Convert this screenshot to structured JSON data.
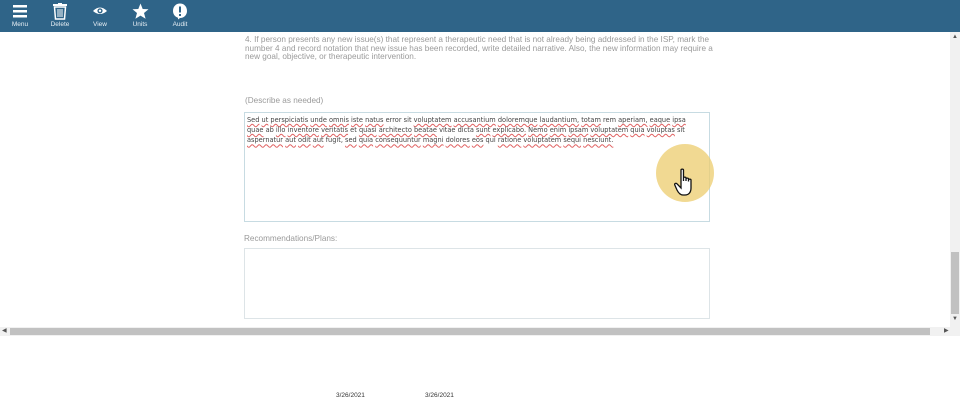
{
  "toolbar": {
    "buttons": [
      {
        "label": "Menu",
        "icon": "hamburger-icon"
      },
      {
        "label": "Delete",
        "icon": "trash-icon"
      },
      {
        "label": "View",
        "icon": "eye-icon"
      },
      {
        "label": "Units",
        "icon": "star-icon"
      },
      {
        "label": "Audit",
        "icon": "alert-icon"
      }
    ],
    "background": "#2f6488"
  },
  "form": {
    "question_4": "4. If person presents any new issue(s) that represent a therapeutic need that is not already being addressed in the ISP, mark the number 4 and record notation that new issue has been recorded, write detailed narrative. Also, the new information may require a new goal, objective, or therapeutic intervention.",
    "describe_label": "(Describe as needed)",
    "describe_value": "Sed ut perspiciatis unde omnis iste natus error sit voluptatem accusantium doloremque laudantium, totam rem aperiam, eaque ipsa quae ab illo inventore veritatis et quasi architecto beatae vitae dicta sunt explicabo. Nemo enim ipsam voluptatem quia voluptas sit aspernatur aut odit aut fugit, sed quia consequuntur magni dolores eos qui ratione voluptatem sequi nesciunt.",
    "recommendations_label": "Recommendations/Plans:",
    "recommendations_value": ""
  },
  "footer": {
    "date_1": "3/26/2021",
    "date_2": "3/26/2021"
  },
  "colors": {
    "spell_underline": "#e06060",
    "click_highlight": "#ecd06e"
  }
}
